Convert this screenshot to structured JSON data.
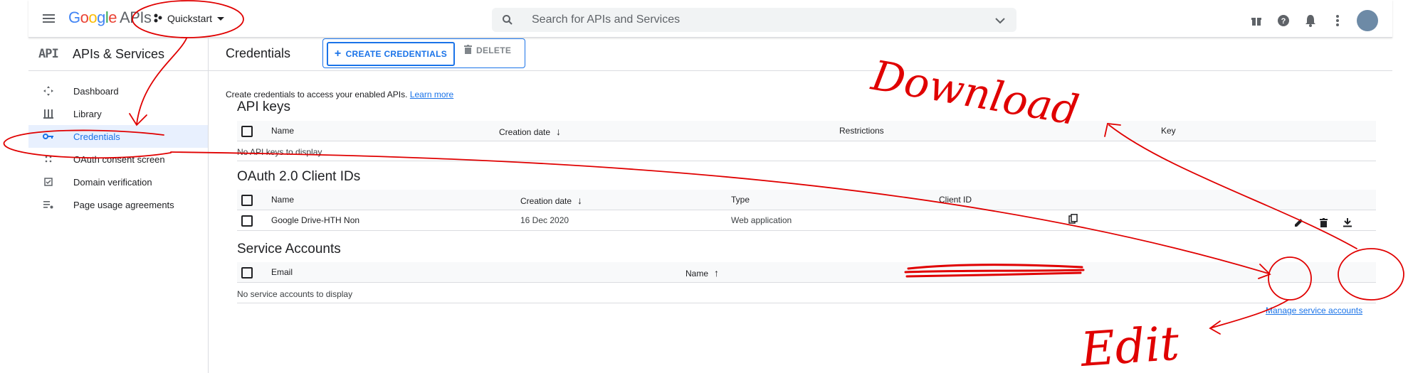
{
  "topbar": {
    "logo_parts": [
      "G",
      "o",
      "o",
      "g",
      "l",
      "e"
    ],
    "logo_suffix": "APIs",
    "project_name": "Quickstart",
    "search_placeholder": "Search for APIs and Services"
  },
  "sidebar": {
    "api_badge": "API",
    "title": "APIs & Services",
    "items": [
      {
        "label": "Dashboard",
        "icon": "dashboard-icon"
      },
      {
        "label": "Library",
        "icon": "library-icon"
      },
      {
        "label": "Credentials",
        "icon": "key-icon",
        "active": true
      },
      {
        "label": "OAuth consent screen",
        "icon": "consent-icon"
      },
      {
        "label": "Domain verification",
        "icon": "checkbox-icon"
      },
      {
        "label": "Page usage agreements",
        "icon": "settings-list-icon"
      }
    ]
  },
  "header": {
    "title": "Credentials",
    "create_label": "CREATE CREDENTIALS",
    "delete_label": "DELETE"
  },
  "main": {
    "intro_text": "Create credentials to access your enabled APIs.",
    "learn_more": "Learn more",
    "api_keys": {
      "title": "API keys",
      "columns": [
        "Name",
        "Creation date",
        "Restrictions",
        "Key"
      ],
      "empty": "No API keys to display"
    },
    "oauth": {
      "title": "OAuth 2.0 Client IDs",
      "columns": [
        "Name",
        "Creation date",
        "Type",
        "Client ID"
      ],
      "rows": [
        {
          "name": "Google Drive-HTH Non",
          "date": "16 Dec 2020",
          "type": "Web application"
        }
      ]
    },
    "service_accounts": {
      "title": "Service Accounts",
      "manage_link": "Manage service accounts",
      "columns": [
        "Email",
        "Name"
      ],
      "empty": "No service accounts to display"
    }
  },
  "annotations": {
    "download": "Download",
    "edit": "Edit"
  },
  "colors": {
    "accent": "#1a73e8",
    "annotation": "#e00000"
  }
}
